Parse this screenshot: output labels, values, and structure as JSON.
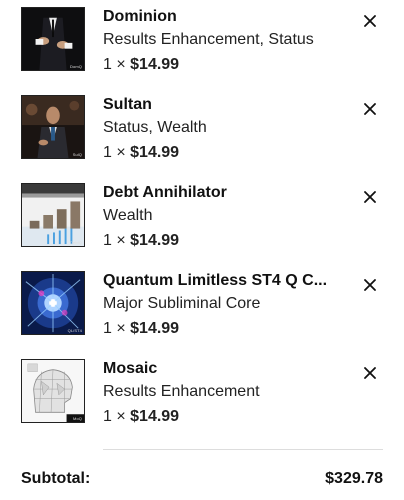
{
  "cart": {
    "items": [
      {
        "title": "Dominion",
        "tags": "Results Enhancement, Status",
        "quantity_prefix": "1 ×",
        "price": "$14.99",
        "thumb_brand": "DomQ",
        "thumb_icon": "man-in-suit-adjusting-cufflinks"
      },
      {
        "title": "Sultan",
        "tags": "Status, Wealth",
        "quantity_prefix": "1 ×",
        "price": "$14.99",
        "thumb_brand": "SulQ",
        "thumb_icon": "man-seated-in-suit"
      },
      {
        "title": "Debt Annihilator",
        "tags": "Wealth",
        "quantity_prefix": "1 ×",
        "price": "$14.99",
        "thumb_brand": "DebtQ",
        "thumb_icon": "coin-stacks-and-chart"
      },
      {
        "title": "Quantum Limitless ST4 Q C...",
        "tags": "Major Subliminal Core",
        "quantity_prefix": "1 ×",
        "price": "$14.99",
        "thumb_brand": "QL/ST4",
        "thumb_icon": "cosmic-light-burst"
      },
      {
        "title": "Mosaic",
        "tags": "Results Enhancement",
        "quantity_prefix": "1 ×",
        "price": "$14.99",
        "thumb_brand": "MoQ",
        "thumb_icon": "mosaic-wireframe-head"
      }
    ],
    "remove_icon": "close-icon"
  },
  "summary": {
    "subtotal_label": "Subtotal:",
    "subtotal_value": "$329.78"
  }
}
